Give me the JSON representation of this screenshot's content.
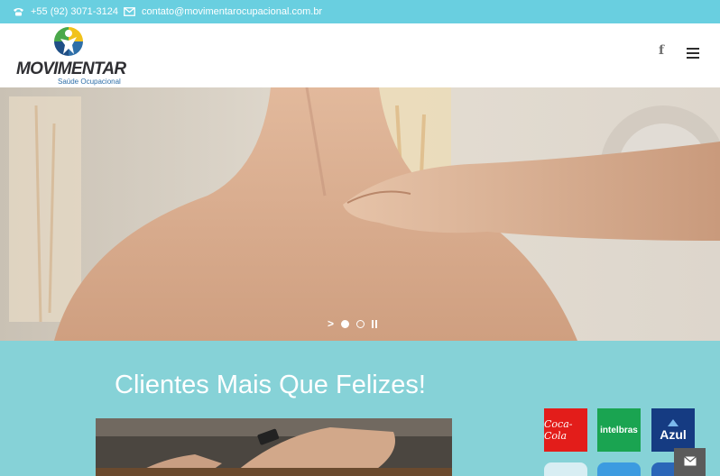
{
  "topbar": {
    "phone": "+55 (92) 3071-3124",
    "phone_icon": "phone-icon",
    "email": "contato@movimentarocupacional.com.br",
    "email_icon": "envelope-icon"
  },
  "header": {
    "logo_name": "MOVIMENTAR",
    "logo_tagline": "Saúde Ocupacional",
    "social_icon": "facebook-icon",
    "social_label": "f",
    "menu_icon": "hamburger-menu-icon"
  },
  "hero": {
    "slide_count": 2,
    "active_slide": 1,
    "controls": [
      "next-arrow-icon",
      "slide-dot",
      "slide-dot",
      "pause-icon"
    ]
  },
  "clients": {
    "title": "Clientes Mais Que Felizes!",
    "logos": [
      {
        "name": "Coca-Cola",
        "label": "Coca-Cola",
        "color": "#e31d1a"
      },
      {
        "name": "Intelbras",
        "label": "intelbras",
        "color": "#1aa451"
      },
      {
        "name": "Azul",
        "label": "Azul",
        "color": "#153b82"
      }
    ]
  },
  "colors": {
    "topbar": "#69cfe0",
    "clients_bg": "#86d2d7",
    "logo_blue": "#2f6fa8",
    "message_button": "#5b5b5b"
  },
  "floating": {
    "message_icon": "envelope-icon"
  }
}
